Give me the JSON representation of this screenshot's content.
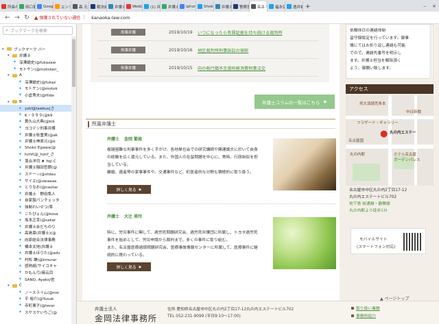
{
  "tabs": [
    {
      "label": "所長の",
      "color": "#d33"
    },
    {
      "label": "田口事",
      "color": "#3a6"
    },
    {
      "label": "Googl",
      "color": "#4285f4"
    },
    {
      "label": "エンリ",
      "color": "#f90"
    },
    {
      "label": "森 元",
      "color": "#555"
    },
    {
      "label": "戦決前",
      "color": "#1a3a6c"
    },
    {
      "label": "弁護士",
      "color": "#38a"
    },
    {
      "label": "WebL",
      "color": "#e33"
    },
    {
      "label": "(1) 弁",
      "color": "#1da1f2"
    },
    {
      "label": "弁護士",
      "color": "#3a6"
    },
    {
      "label": "iphon",
      "color": "#4285f4"
    },
    {
      "label": "Shoko",
      "color": "#1da1f2"
    },
    {
      "label": "弁護士",
      "color": "#38a"
    },
    {
      "label": "警察官",
      "color": "#1a3a6c"
    },
    {
      "label": "名古",
      "color": "#555",
      "active": true
    },
    {
      "label": "福永弘",
      "color": "#1da1f2"
    },
    {
      "label": "酒井裕",
      "color": "#1da1f2"
    }
  ],
  "address": {
    "warning": "保護されていない通信",
    "url": "kanaoka-law.com"
  },
  "sidebar": {
    "search_placeholder": "ブックマークを検索",
    "rows": [
      {
        "label": "ブックマーク バー",
        "type": "folder",
        "indent": 0
      },
      {
        "label": "弁護士",
        "type": "folder",
        "indent": 1
      },
      {
        "label": "深澤諭史(@fukazaw",
        "type": "tw",
        "indent": 2
      },
      {
        "label": "モトケン(@motoken_",
        "type": "tw",
        "indent": 2
      },
      {
        "label": "A",
        "type": "folder",
        "indent": 1
      },
      {
        "label": "深澤諭史(@fukaz",
        "type": "tw",
        "indent": 3
      },
      {
        "label": "モトケン(@motok",
        "type": "tw",
        "indent": 3
      },
      {
        "label": "小倉秀夫(@Hide",
        "type": "tw",
        "indent": 3
      },
      {
        "label": "B",
        "type": "folder",
        "indent": 1
      },
      {
        "label": "yzkl@lawkus|さ",
        "type": "tw",
        "indent": 3,
        "selected": true
      },
      {
        "label": "K・９９９(@k9",
        "type": "tw",
        "indent": 3
      },
      {
        "label": "蓑久山大典(@kik",
        "type": "tw",
        "indent": 3
      },
      {
        "label": "ヨコテン刑事弁護",
        "type": "tw",
        "indent": 3
      },
      {
        "label": "弁護士秋重実(@ak",
        "type": "tw",
        "indent": 3
      },
      {
        "label": "弁護士神原元(@k",
        "type": "tw",
        "indent": 3
      },
      {
        "label": "Shoko Egawa(@",
        "type": "tw",
        "indent": 3
      },
      {
        "label": "hznf(@_hznf_さ",
        "type": "tw",
        "indent": 3
      },
      {
        "label": "落合洋司 ♦ Yoji C",
        "type": "tw",
        "indent": 3
      },
      {
        "label": "弁護士稲田哲朗(@",
        "type": "tw",
        "indent": 3
      },
      {
        "label": "スドー☆(@stdau",
        "type": "tw",
        "indent": 3
      },
      {
        "label": "サイエ(@uwaaaa",
        "type": "tw",
        "indent": 3
      },
      {
        "label": "とりなお(@naotar",
        "type": "tw",
        "indent": 3
      },
      {
        "label": "弁護士　野田隼人",
        "type": "tw",
        "indent": 3
      },
      {
        "label": "自家製パンチェッタ",
        "type": "tw",
        "indent": 3
      },
      {
        "label": "強制わいせつ/準",
        "type": "tw",
        "indent": 3
      },
      {
        "label": "こたぴょん(@kosa",
        "type": "tw",
        "indent": 3
      },
      {
        "label": "坂本正幸(@sakar",
        "type": "tw",
        "indent": 3
      },
      {
        "label": "弁護士あだちのり",
        "type": "tw",
        "indent": 3
      },
      {
        "label": "高島章(弁護士)(@",
        "type": "tw",
        "indent": 3
      },
      {
        "label": "向原総合法律事務",
        "type": "tw",
        "indent": 3
      },
      {
        "label": "橋本太地(弁護士",
        "type": "tw",
        "indent": 3
      },
      {
        "label": "弁護士ほりた(@adv",
        "type": "tw",
        "indent": 3
      },
      {
        "label": "村松 謙(@kmurar",
        "type": "tw",
        "indent": 3
      },
      {
        "label": "感熱紙(サイコキャ",
        "type": "tw",
        "indent": 3
      },
      {
        "label": "かもん弓(暁云目",
        "type": "tw",
        "indent": 3
      },
      {
        "label": "SANO, Ayako/佐",
        "type": "tw",
        "indent": 3
      },
      {
        "label": "C",
        "type": "folder",
        "indent": 1
      },
      {
        "label": "ノースライム(@nor",
        "type": "tw",
        "indent": 3
      },
      {
        "label": "平 裕介(@Yusuk",
        "type": "tw",
        "indent": 3
      },
      {
        "label": "寺町東子(@terar",
        "type": "tw",
        "indent": 3
      },
      {
        "label": "スヤスヤいちご(@",
        "type": "tw",
        "indent": 3
      }
    ]
  },
  "column_list": [
    {
      "category": "刑事弁護",
      "date": "2019/10/19",
      "title": "いつになったら有罪証拠を持ち続ける裁判所"
    },
    {
      "category": "刑事弁護",
      "date": "2019/10/16",
      "title": "地区裁判所刑事訴訟の保釈"
    },
    {
      "category": "刑事弁護",
      "date": "2019/10/15",
      "title": "向の執行猶予言渡刑務消費刑事法交"
    }
  ],
  "column_more": {
    "label": "弁護士コラムの一覧はこちら",
    "arrow": "▶"
  },
  "lawyers_section": {
    "title": "所属弁護士"
  },
  "lawyers": [
    {
      "role": "弁護士",
      "name": "金岡 繁裕",
      "desc": "複雑困難な刑事事件を多く手がけ、各地単位会での研究講師や関連論文に於いて自身の経験を広く還元している。また、外国人の在留問題を中心に、常時、行政訴訟を担当している。",
      "desc2": "離婚、遺産等の家事事件や、交通事件など、町医者的な分野も積極的に取り扱う。",
      "button": "詳しく見る"
    },
    {
      "role": "弁護士",
      "name": "大辻 美玲",
      "desc": "特に、労災事件に関して、過労死問題研究会、過労死弁護団に所属し、トヨタ過労死事件を始めとして、労災申請から裁判まで、多くの事件に取り組む。",
      "desc2": "また、名古屋医療過誤問題研究会、医療事故情報センターに所属して、医療事件に継続的に携わっている。",
      "button": "詳しく見る"
    }
  ],
  "page_top": "▲ ページトップ",
  "footer": {
    "kind": "弁護士法人",
    "name": "金岡法律事務所",
    "address": "住所 愛知県名古屋市中区丸の内2丁目17-12丸の内エステートビル702",
    "tel": "TEL 052-231-9099 (平日9:10〜17:00)",
    "links": [
      "取り扱い業務",
      "事務所紹介"
    ]
  },
  "right": {
    "notice": [
      "依頼休日の連絡体制",
      "留守録設定を行っています。御事",
      "情にてはお折り返し連絡も可能",
      "でので、連絡先番号を明示し",
      "ます。弁護士担当を解除頂く",
      "よう、御願い致します。"
    ],
    "access_title": "アクセス",
    "map_labels": [
      "呉大須読売条本",
      "中日新聞",
      "フラザード・ギャラリー",
      "丸の内エステー",
      "名古屋国",
      "丸の内駅",
      "ホテル名古屋",
      "ガーデンパレス"
    ],
    "info": [
      "名古屋市中区丸の内2丁目17-12",
      "丸の内エステートビル702",
      "地下鉄 桜通線・鶴舞線",
      "丸の内駅より徒歩1分"
    ],
    "mobile": {
      "line1": "モバイルサイト",
      "line2": "(スマートフォン対応)"
    }
  }
}
